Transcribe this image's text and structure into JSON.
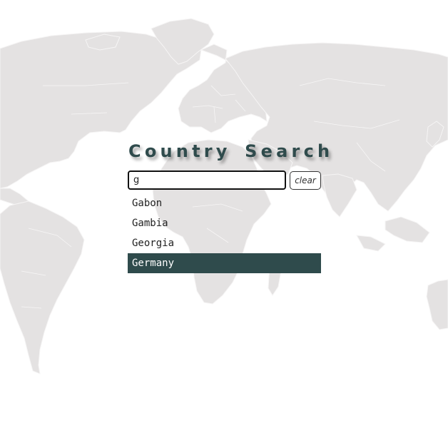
{
  "page": {
    "title": "Country Search"
  },
  "search": {
    "value": "g",
    "clear_label": "clear"
  },
  "results": [
    {
      "label": "Gabon",
      "selected": false
    },
    {
      "label": "Gambia",
      "selected": false
    },
    {
      "label": "Georgia",
      "selected": false
    },
    {
      "label": "Germany",
      "selected": true
    }
  ],
  "colors": {
    "accent": "#2f4b4c",
    "map_land": "#e4e2e2",
    "background": "#ffffff"
  }
}
